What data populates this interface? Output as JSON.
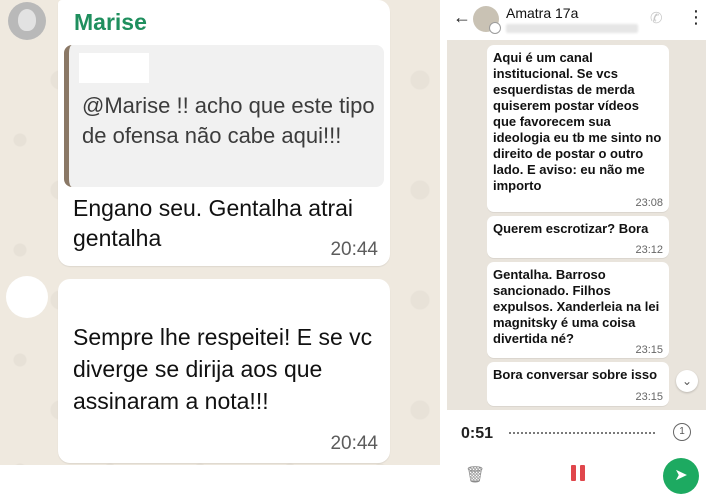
{
  "left_chat": {
    "message1": {
      "sender": "Marise",
      "quoted_text": "@Marise  !! acho que este tipo de ofensa não cabe aqui!!!",
      "text": "Engano seu. Gentalha atrai gentalha",
      "time": "20:44"
    },
    "message2": {
      "text": "Sempre lhe respeitei! E se vc diverge se dirija aos que assinaram a nota!!!",
      "time": "20:44"
    }
  },
  "right_chat": {
    "header": {
      "title": "Amatra 17a",
      "back_icon": "←",
      "menu_icon": "⋮"
    },
    "messages": [
      {
        "text": "Aqui é um canal institucional.  Se vcs esquerdistas de merda quiserem postar vídeos que favorecem sua ideologia eu tb me sinto no direito de postar o outro lado. E aviso: eu não me importo",
        "time": "23:08"
      },
      {
        "text": "Querem escrotizar? Bora",
        "time": "23:12"
      },
      {
        "text": "Gentalha. Barroso sancionado. Filhos expulsos. Xanderleia na lei magnitsky é uma coisa divertida né?",
        "time": "23:15"
      },
      {
        "text": "Bora conversar sobre isso",
        "time": "23:15"
      }
    ],
    "voice_recording": {
      "duration": "0:51",
      "speed_label": "1"
    }
  },
  "colors": {
    "sender_name": "#1f8f5e",
    "send_button": "#1daa61",
    "pause_icon": "#e0474c",
    "chat_background": "#efe9df"
  },
  "icons": {
    "scroll_down": "chevron-double-down-icon",
    "send": "send-icon",
    "delete": "trash-icon",
    "pause": "pause-icon"
  }
}
